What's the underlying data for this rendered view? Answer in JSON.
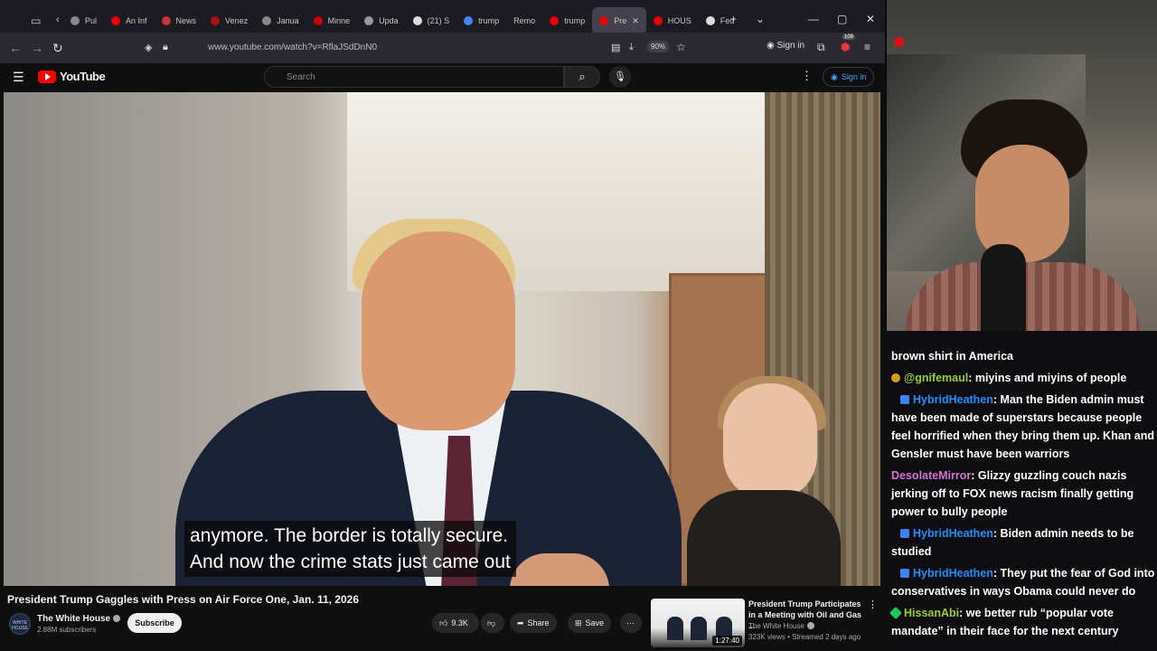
{
  "browser": {
    "tabs": [
      "Pul",
      "An Inf",
      "News",
      "Venez",
      "Janua",
      "Minne",
      "Upda",
      "(21) S",
      "trump",
      "Remo",
      "trump",
      "Pre",
      "HOUS",
      "Fed"
    ],
    "url": "www.youtube.com/watch?v=RflaJSdDnN0",
    "zoom": "90%",
    "signin_label": "Sign in",
    "badge_count": "109"
  },
  "youtube": {
    "logo_text": "YouTube",
    "search_placeholder": "Search",
    "signin_label": "Sign in"
  },
  "video": {
    "caption_lines": [
      "anymore. The border is totally secure.",
      "And now the crime stats just came out"
    ],
    "title": "President Trump Gaggles with Press on Air Force One, Jan. 11, 2026",
    "channel": "The White House",
    "subscribers": "2.88M subscribers",
    "subscribe_label": "Subscribe",
    "likes": "9.3K",
    "share_label": "Share",
    "save_label": "Save",
    "avatar_text": "WHITE HOUSE"
  },
  "recommended": {
    "title": "President Trump Participates in a Meeting with Oil and Gas ...",
    "channel": "The White House",
    "meta": "323K views • Streamed 2 days ago",
    "duration": "1:27:40"
  },
  "chat": [
    {
      "user": "",
      "text": "brown shirt in America",
      "color": "#ffffff"
    },
    {
      "user": "@gnifemaul",
      "text": ": miyins and miyins of people",
      "color": "#9acd32"
    },
    {
      "user": "HybridHeathen",
      "text": ": Man the Biden admin must have been made of superstars because people feel horrified when they bring them up. Khan and Gensler must have been warriors",
      "color": "#1e90ff"
    },
    {
      "user": "DesolateMirror",
      "text": ": Glizzy guzzling couch nazis jerking off to FOX news racism finally getting power to bully people",
      "color": "#da70d6"
    },
    {
      "user": "HybridHeathen",
      "text": ": Biden admin needs to be studied",
      "color": "#1e90ff"
    },
    {
      "user": "HybridHeathen",
      "text": ": They put the fear of God into conservatives in ways Obama could never do",
      "color": "#1e90ff"
    },
    {
      "user": "HissanAbi",
      "text": ": we better rub “popular vote mandate” in their face for the next century",
      "color": "#9acd32"
    }
  ],
  "colors": {
    "accent": "#ff0000",
    "link": "#3ea6ff",
    "chat_bg": "#0e0e10"
  }
}
